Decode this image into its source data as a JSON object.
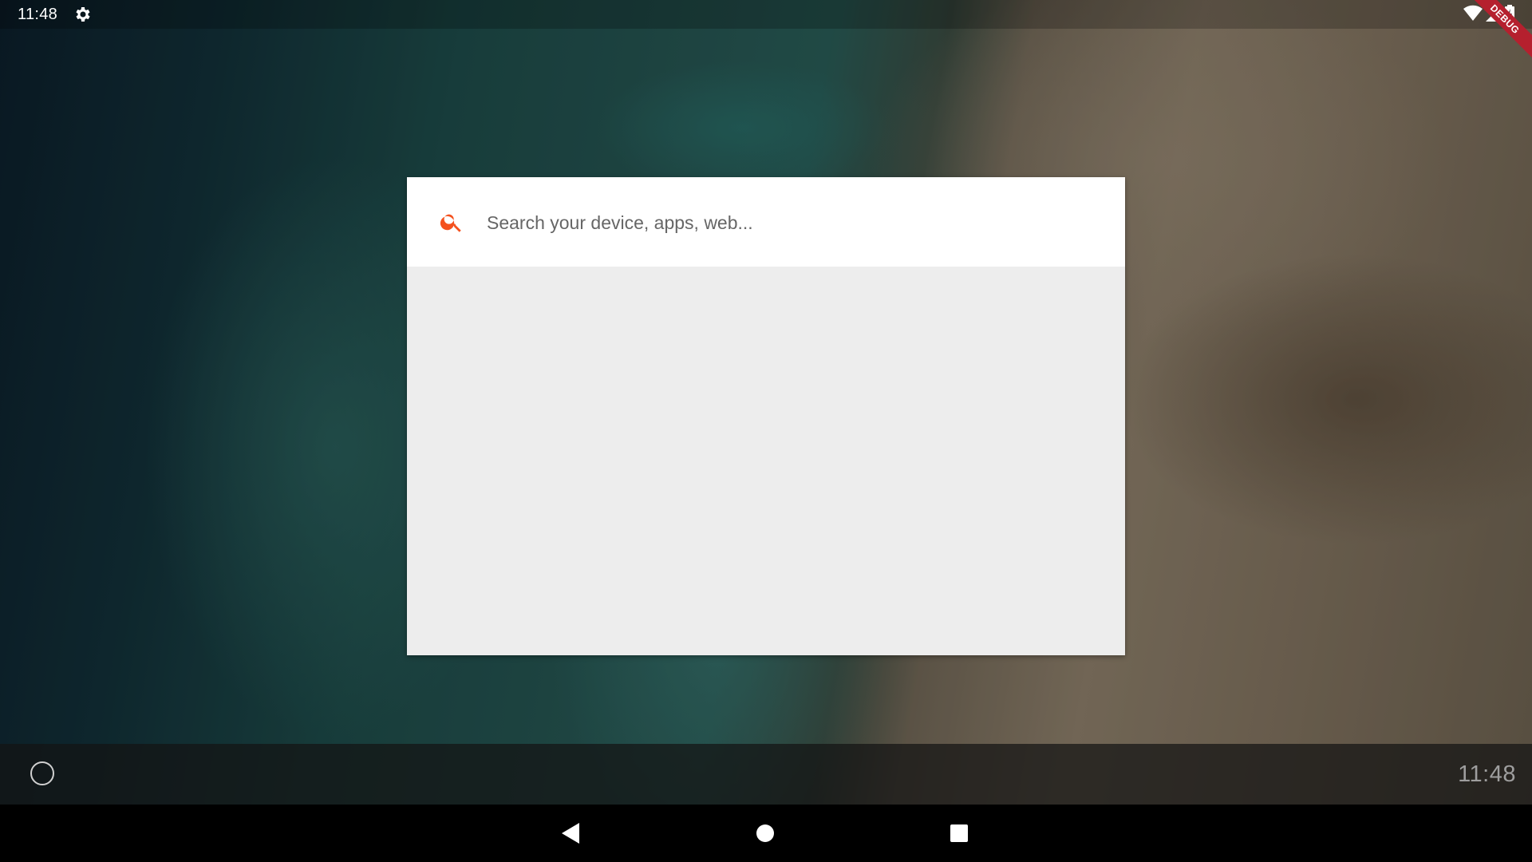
{
  "status_bar": {
    "time": "11:48",
    "icons": [
      "gear-icon",
      "wifi-icon",
      "signal-icon",
      "battery-icon"
    ],
    "debug_label": "DEBUG"
  },
  "search": {
    "placeholder": "Search your device, apps, web...",
    "value": "",
    "icon": "search-icon",
    "accent_color": "#f4511e"
  },
  "taskbar": {
    "clock": "11:48",
    "app_drawer_icon": "circle-icon"
  },
  "nav_bar": {
    "buttons": [
      "back-icon",
      "home-icon",
      "recents-icon"
    ]
  },
  "colors": {
    "card_header": "#ffffff",
    "card_body": "#ededed",
    "debug_banner": "#b5202e"
  }
}
